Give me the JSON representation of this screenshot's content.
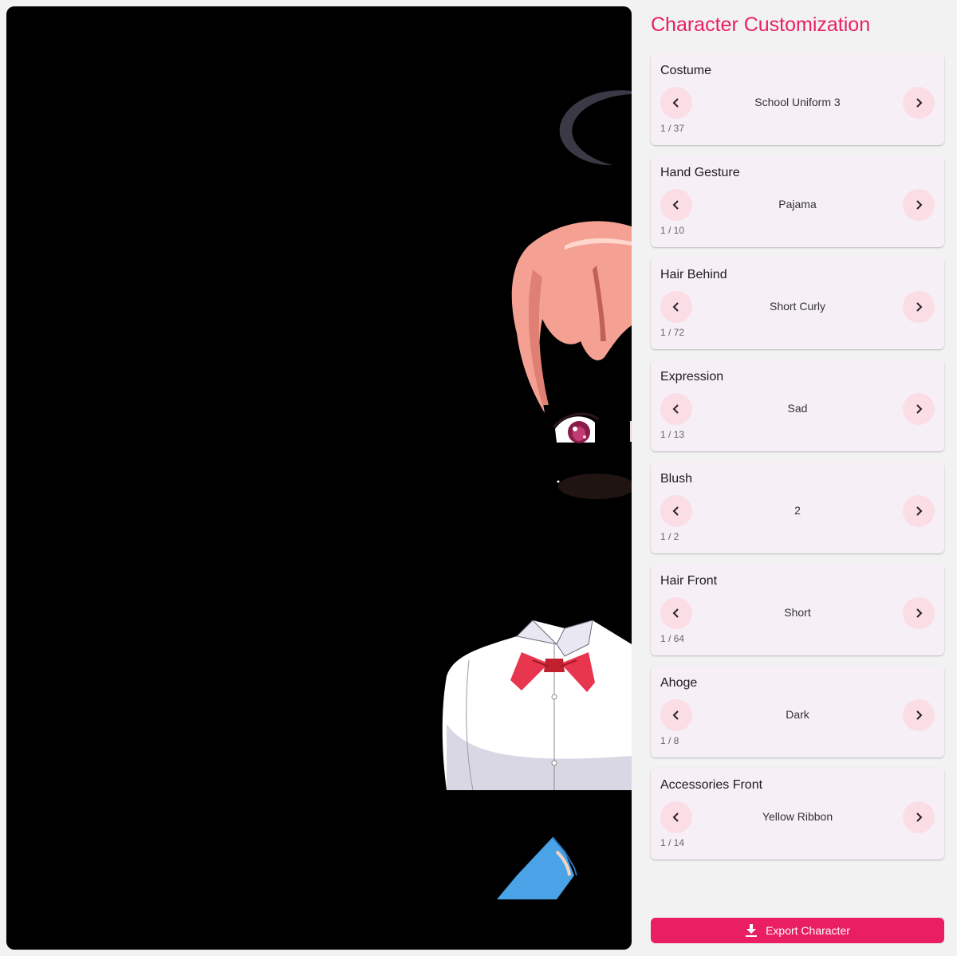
{
  "title": "Character Customization",
  "categories": [
    {
      "label": "Costume",
      "value": "School Uniform 3",
      "count": "1 / 37"
    },
    {
      "label": "Hand Gesture",
      "value": "Pajama",
      "count": "1 / 10"
    },
    {
      "label": "Hair Behind",
      "value": "Short Curly",
      "count": "1 / 72"
    },
    {
      "label": "Expression",
      "value": "Sad",
      "count": "1 / 13"
    },
    {
      "label": "Blush",
      "value": "2",
      "count": "1 / 2"
    },
    {
      "label": "Hair Front",
      "value": "Short",
      "count": "1 / 64"
    },
    {
      "label": "Ahoge",
      "value": "Dark",
      "count": "1 / 8"
    },
    {
      "label": "Accessories Front",
      "value": "Yellow Ribbon",
      "count": "1 / 14"
    }
  ],
  "export_label": "Export Character",
  "icons": {
    "prev": "chevron-left-icon",
    "next": "chevron-right-icon",
    "export": "download-icon"
  },
  "colors": {
    "accent": "#e91e63",
    "card_bg": "#f6eff5",
    "nav_button_bg": "#fbdde6",
    "canvas_bg": "#000000"
  }
}
